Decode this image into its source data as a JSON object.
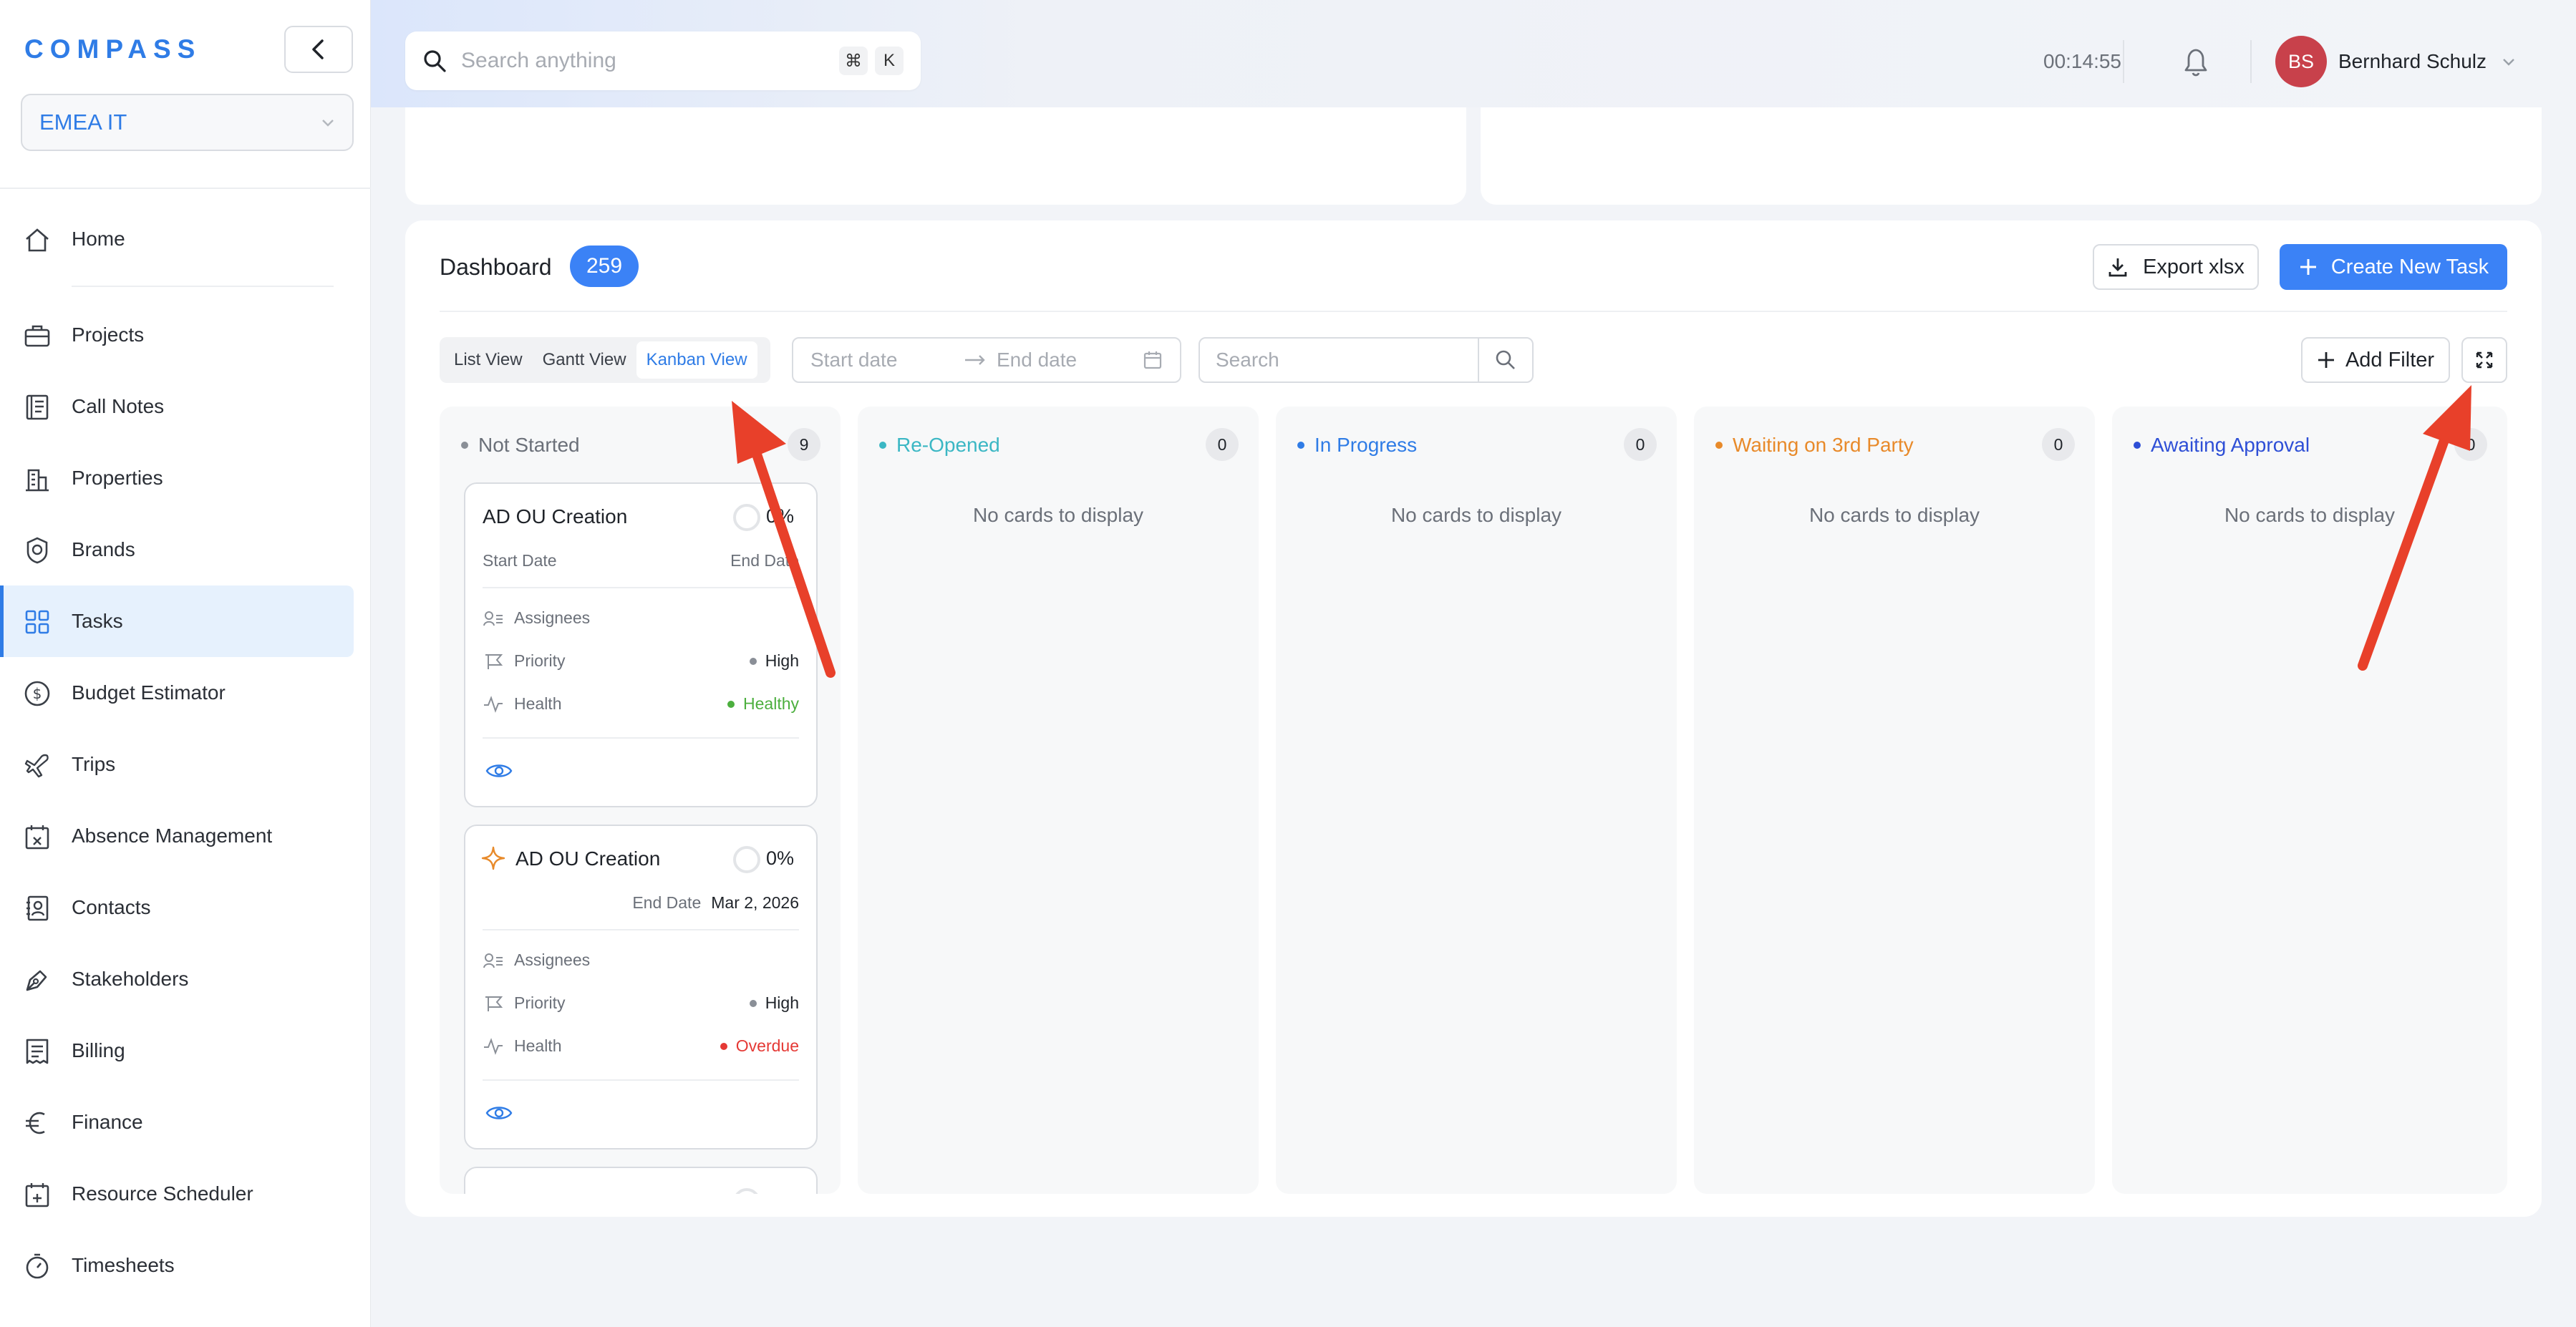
{
  "app": {
    "logo": "COMPASS"
  },
  "org_select": {
    "value": "EMEA IT"
  },
  "sidebar": {
    "items": [
      {
        "label": "Home",
        "icon": "home-icon"
      },
      {
        "label": "Projects",
        "icon": "briefcase-icon"
      },
      {
        "label": "Call Notes",
        "icon": "notes-icon"
      },
      {
        "label": "Properties",
        "icon": "building-icon"
      },
      {
        "label": "Brands",
        "icon": "badge-icon"
      },
      {
        "label": "Tasks",
        "icon": "grid-icon",
        "active": true
      },
      {
        "label": "Budget Estimator",
        "icon": "dollar-icon"
      },
      {
        "label": "Trips",
        "icon": "plane-icon"
      },
      {
        "label": "Absence Management",
        "icon": "calendar-x-icon"
      },
      {
        "label": "Contacts",
        "icon": "contacts-icon"
      },
      {
        "label": "Stakeholders",
        "icon": "pen-icon"
      },
      {
        "label": "Billing",
        "icon": "billing-icon"
      },
      {
        "label": "Finance",
        "icon": "euro-icon"
      },
      {
        "label": "Resource Scheduler",
        "icon": "calendar-plus-icon"
      },
      {
        "label": "Timesheets",
        "icon": "stopwatch-icon"
      }
    ]
  },
  "topbar": {
    "search_placeholder": "Search anything",
    "shortcut_1": "⌘",
    "shortcut_2": "K",
    "timer": "00:14:55",
    "user_initials": "BS",
    "user_name": "Bernhard Schulz"
  },
  "dashboard": {
    "title": "Dashboard",
    "count": "259",
    "export_label": "Export xlsx",
    "create_label": "Create New Task",
    "views": [
      "List View",
      "Gantt View",
      "Kanban View"
    ],
    "selected_view": "Kanban View",
    "start_placeholder": "Start date",
    "end_placeholder": "End date",
    "search_placeholder": "Search",
    "add_filter_label": "Add Filter"
  },
  "columns": [
    {
      "title": "Not Started",
      "count": "9",
      "color": "#8a8f97"
    },
    {
      "title": "Re-Opened",
      "count": "0",
      "color": "#3bb7c4",
      "empty": "No cards to display"
    },
    {
      "title": "In Progress",
      "count": "0",
      "color": "#2f7ce6",
      "empty": "No cards to display"
    },
    {
      "title": "Waiting on 3rd Party",
      "count": "0",
      "color": "#e88a2a",
      "empty": "No cards to display"
    },
    {
      "title": "Awaiting Approval",
      "count": "0",
      "color": "#2e4fd6",
      "empty": "No cards to display"
    }
  ],
  "cards": [
    {
      "title": "AD OU Creation",
      "progress": "0%",
      "start_label": "Start Date",
      "end_label": "End Date",
      "assignees_label": "Assignees",
      "priority_label": "Priority",
      "priority": "High",
      "health_label": "Health",
      "health": "Healthy",
      "health_color": "#4caf3e"
    },
    {
      "title": "AD OU Creation",
      "progress": "0%",
      "end_label": "End Date",
      "end_value": "Mar 2, 2026",
      "assignees_label": "Assignees",
      "priority_label": "Priority",
      "priority": "High",
      "health_label": "Health",
      "health": "Overdue",
      "health_color": "#e53935"
    }
  ],
  "colors": {
    "accent": "#3b82f6",
    "annotation": "#e8402a"
  }
}
